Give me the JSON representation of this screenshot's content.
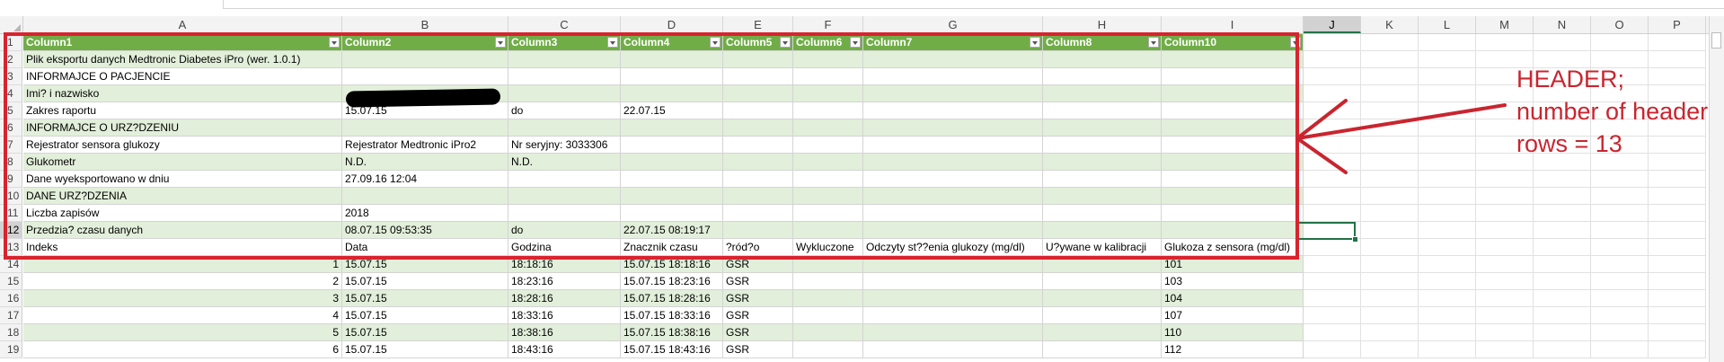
{
  "columns": [
    {
      "letter": "A",
      "w": 355
    },
    {
      "letter": "B",
      "w": 185
    },
    {
      "letter": "C",
      "w": 125
    },
    {
      "letter": "D",
      "w": 114
    },
    {
      "letter": "E",
      "w": 78
    },
    {
      "letter": "F",
      "w": 78
    },
    {
      "letter": "G",
      "w": 200
    },
    {
      "letter": "H",
      "w": 132
    },
    {
      "letter": "I",
      "w": 158
    },
    {
      "letter": "J",
      "w": 64
    },
    {
      "letter": "K",
      "w": 64
    },
    {
      "letter": "L",
      "w": 64
    },
    {
      "letter": "M",
      "w": 64
    },
    {
      "letter": "N",
      "w": 64
    },
    {
      "letter": "O",
      "w": 64
    },
    {
      "letter": "P",
      "w": 64
    }
  ],
  "selected_column": "J",
  "selected_row": "12",
  "rows": [
    {
      "n": "1",
      "style": "hdr",
      "cells": [
        "Column1",
        "Column2",
        "Column3",
        "Column4",
        "Column5",
        "Column6",
        "Column7",
        "Column8",
        "Column10"
      ]
    },
    {
      "n": "2",
      "style": "band",
      "cells": [
        "Plik eksportu danych Medtronic Diabetes iPro (wer. 1.0.1)",
        "",
        "",
        "",
        "",
        "",
        "",
        "",
        ""
      ]
    },
    {
      "n": "3",
      "style": "white",
      "cells": [
        "INFORMAJCE O PACJENCIE",
        "",
        "",
        "",
        "",
        "",
        "",
        "",
        ""
      ]
    },
    {
      "n": "4",
      "style": "band",
      "cells": [
        "Imi? i nazwisko",
        "",
        "",
        "",
        "",
        "",
        "",
        "",
        ""
      ]
    },
    {
      "n": "5",
      "style": "white",
      "cells": [
        "Zakres raportu",
        "15.07.15",
        "do",
        "22.07.15",
        "",
        "",
        "",
        "",
        ""
      ]
    },
    {
      "n": "6",
      "style": "band",
      "cells": [
        "INFORMAJCE O URZ?DZENIU",
        "",
        "",
        "",
        "",
        "",
        "",
        "",
        ""
      ]
    },
    {
      "n": "7",
      "style": "white",
      "cells": [
        "Rejestrator sensora glukozy",
        "Rejestrator Medtronic iPro2",
        "Nr seryjny: 3033306",
        "",
        "",
        "",
        "",
        "",
        ""
      ]
    },
    {
      "n": "8",
      "style": "band",
      "cells": [
        "Glukometr",
        "N.D.",
        "N.D.",
        "",
        "",
        "",
        "",
        "",
        ""
      ]
    },
    {
      "n": "9",
      "style": "white",
      "cells": [
        "Dane wyeksportowano w dniu",
        "27.09.16 12:04",
        "",
        "",
        "",
        "",
        "",
        "",
        ""
      ]
    },
    {
      "n": "10",
      "style": "band",
      "cells": [
        "DANE URZ?DZENIA",
        "",
        "",
        "",
        "",
        "",
        "",
        "",
        ""
      ]
    },
    {
      "n": "11",
      "style": "white",
      "cells": [
        "Liczba zapisów",
        "2018",
        "",
        "",
        "",
        "",
        "",
        "",
        ""
      ]
    },
    {
      "n": "12",
      "style": "band",
      "cells": [
        "Przedzia? czasu danych",
        "08.07.15 09:53:35",
        "do",
        "22.07.15 08:19:17",
        "",
        "",
        "",
        "",
        ""
      ]
    },
    {
      "n": "13",
      "style": "white",
      "cells": [
        "Indeks",
        "Data",
        "Godzina",
        "Znacznik czasu",
        "?ród?o",
        "Wykluczone",
        "Odczyty st??enia glukozy (mg/dl)",
        "U?ywane w kalibracji",
        "Glukoza z sensora (mg/dl)"
      ]
    },
    {
      "n": "14",
      "style": "band",
      "cells": [
        "1",
        "15.07.15",
        "18:18:16",
        "15.07.15 18:18:16",
        "GSR",
        "",
        "",
        "",
        "101"
      ]
    },
    {
      "n": "15",
      "style": "white",
      "cells": [
        "2",
        "15.07.15",
        "18:23:16",
        "15.07.15 18:23:16",
        "GSR",
        "",
        "",
        "",
        "103"
      ]
    },
    {
      "n": "16",
      "style": "band",
      "cells": [
        "3",
        "15.07.15",
        "18:28:16",
        "15.07.15 18:28:16",
        "GSR",
        "",
        "",
        "",
        "104"
      ]
    },
    {
      "n": "17",
      "style": "white",
      "cells": [
        "4",
        "15.07.15",
        "18:33:16",
        "15.07.15 18:33:16",
        "GSR",
        "",
        "",
        "",
        "107"
      ]
    },
    {
      "n": "18",
      "style": "band",
      "cells": [
        "5",
        "15.07.15",
        "18:38:16",
        "15.07.15 18:38:16",
        "GSR",
        "",
        "",
        "",
        "110"
      ]
    },
    {
      "n": "19",
      "style": "white",
      "cells": [
        "6",
        "15.07.15",
        "18:43:16",
        "15.07.15 18:43:16",
        "GSR",
        "",
        "",
        "",
        "112"
      ]
    }
  ],
  "annotation": {
    "text": "HEADER;\nnumber of header\nrows = 13",
    "color": "#c9252f"
  },
  "colors": {
    "header_green": "#70ad47",
    "band_green": "#e2efda",
    "annotation_red": "#d9232e",
    "selection_green": "#217346"
  }
}
